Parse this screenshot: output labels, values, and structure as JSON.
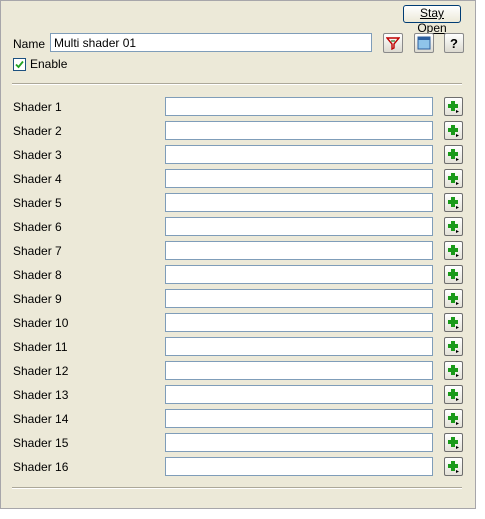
{
  "toolbar": {
    "stay_open_label": "Stay Open",
    "icons": [
      "material-filter-icon",
      "preview-window-icon",
      "help-icon"
    ]
  },
  "name": {
    "label": "Name",
    "value": "Multi shader 01"
  },
  "enable": {
    "label": "Enable",
    "checked": true
  },
  "shaders": [
    {
      "label": "Shader 1",
      "value": ""
    },
    {
      "label": "Shader 2",
      "value": ""
    },
    {
      "label": "Shader 3",
      "value": ""
    },
    {
      "label": "Shader 4",
      "value": ""
    },
    {
      "label": "Shader 5",
      "value": ""
    },
    {
      "label": "Shader 6",
      "value": ""
    },
    {
      "label": "Shader 7",
      "value": ""
    },
    {
      "label": "Shader 8",
      "value": ""
    },
    {
      "label": "Shader 9",
      "value": ""
    },
    {
      "label": "Shader 10",
      "value": ""
    },
    {
      "label": "Shader 11",
      "value": ""
    },
    {
      "label": "Shader 12",
      "value": ""
    },
    {
      "label": "Shader 13",
      "value": ""
    },
    {
      "label": "Shader 14",
      "value": ""
    },
    {
      "label": "Shader 15",
      "value": ""
    },
    {
      "label": "Shader 16",
      "value": ""
    }
  ],
  "colors": {
    "panel": "#ece9d8",
    "input_border": "#7f9db9",
    "add_icon_green": "#1a9a1a"
  }
}
